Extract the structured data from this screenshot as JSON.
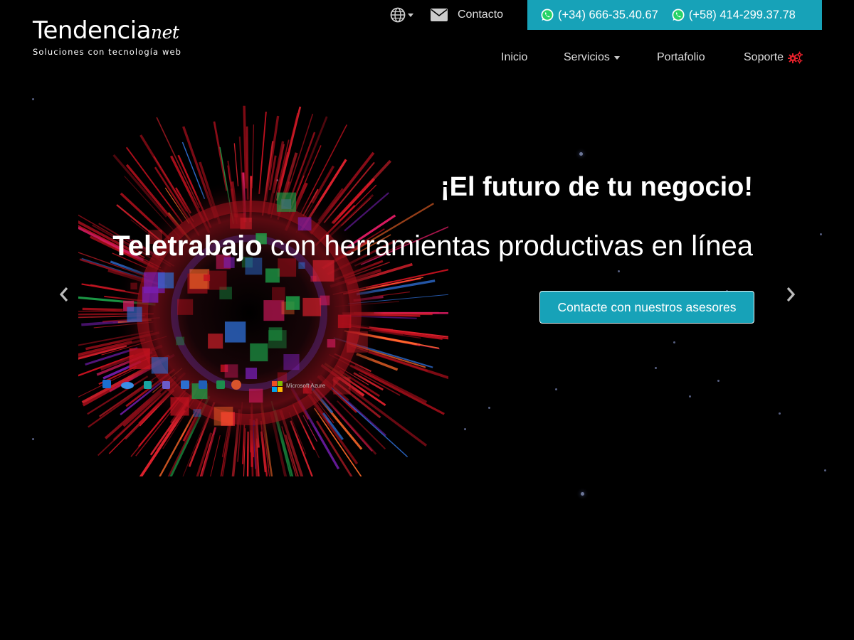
{
  "brand": {
    "name_main": "Tendencia",
    "name_suffix": "net",
    "tagline": "Soluciones con tecnología web"
  },
  "topbar": {
    "language_icon": "globe-icon",
    "contact_label": "Contacto",
    "contact_icon": "envelope-icon",
    "phones": [
      {
        "icon": "whatsapp-icon",
        "number": "(+34) 666-35.40.67"
      },
      {
        "icon": "whatsapp-icon",
        "number": "(+58) 414-299.37.78"
      }
    ],
    "accent_color": "#17a2b8"
  },
  "nav": {
    "items": [
      {
        "label": "Inicio"
      },
      {
        "label": "Servicios",
        "dropdown": true
      },
      {
        "label": "Portafolio"
      },
      {
        "label": "Soporte",
        "icon": "gears-icon",
        "icon_color": "#e8212b"
      }
    ]
  },
  "hero": {
    "headline": "¡El futuro de tu negocio!",
    "subline_bold": "Teletrabajo",
    "subline_rest": " con herramientas productivas en línea",
    "cta_label": "Contacte con nuestros asesores",
    "prev_icon": "chevron-left-icon",
    "next_icon": "chevron-right-icon",
    "art_caption": "Microsoft Azure"
  }
}
